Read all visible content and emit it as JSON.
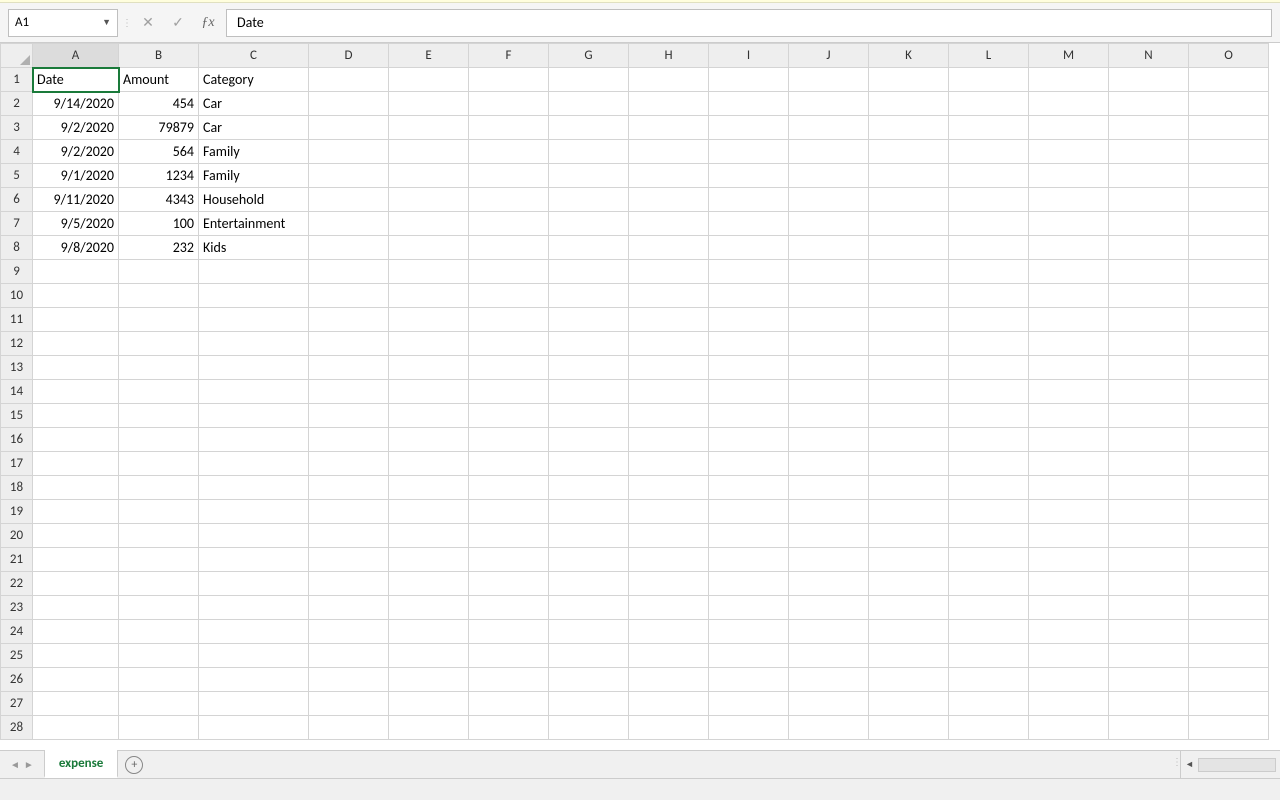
{
  "name_box": "A1",
  "formula_value": "Date",
  "columns": [
    "A",
    "B",
    "C",
    "D",
    "E",
    "F",
    "G",
    "H",
    "I",
    "J",
    "K",
    "L",
    "M",
    "N",
    "O"
  ],
  "row_count": 28,
  "headers": {
    "A": "Date",
    "B": "Amount",
    "C": "Category"
  },
  "rows": [
    {
      "A": "9/14/2020",
      "B": "454",
      "C": "Car"
    },
    {
      "A": "9/2/2020",
      "B": "79879",
      "C": "Car"
    },
    {
      "A": "9/2/2020",
      "B": "564",
      "C": "Family"
    },
    {
      "A": "9/1/2020",
      "B": "1234",
      "C": "Family"
    },
    {
      "A": "9/11/2020",
      "B": "4343",
      "C": "Household"
    },
    {
      "A": "9/5/2020",
      "B": "100",
      "C": "Entertainment"
    },
    {
      "A": "9/8/2020",
      "B": "232",
      "C": "Kids"
    }
  ],
  "sheet_tab": "expense",
  "selected_cell": "A1"
}
